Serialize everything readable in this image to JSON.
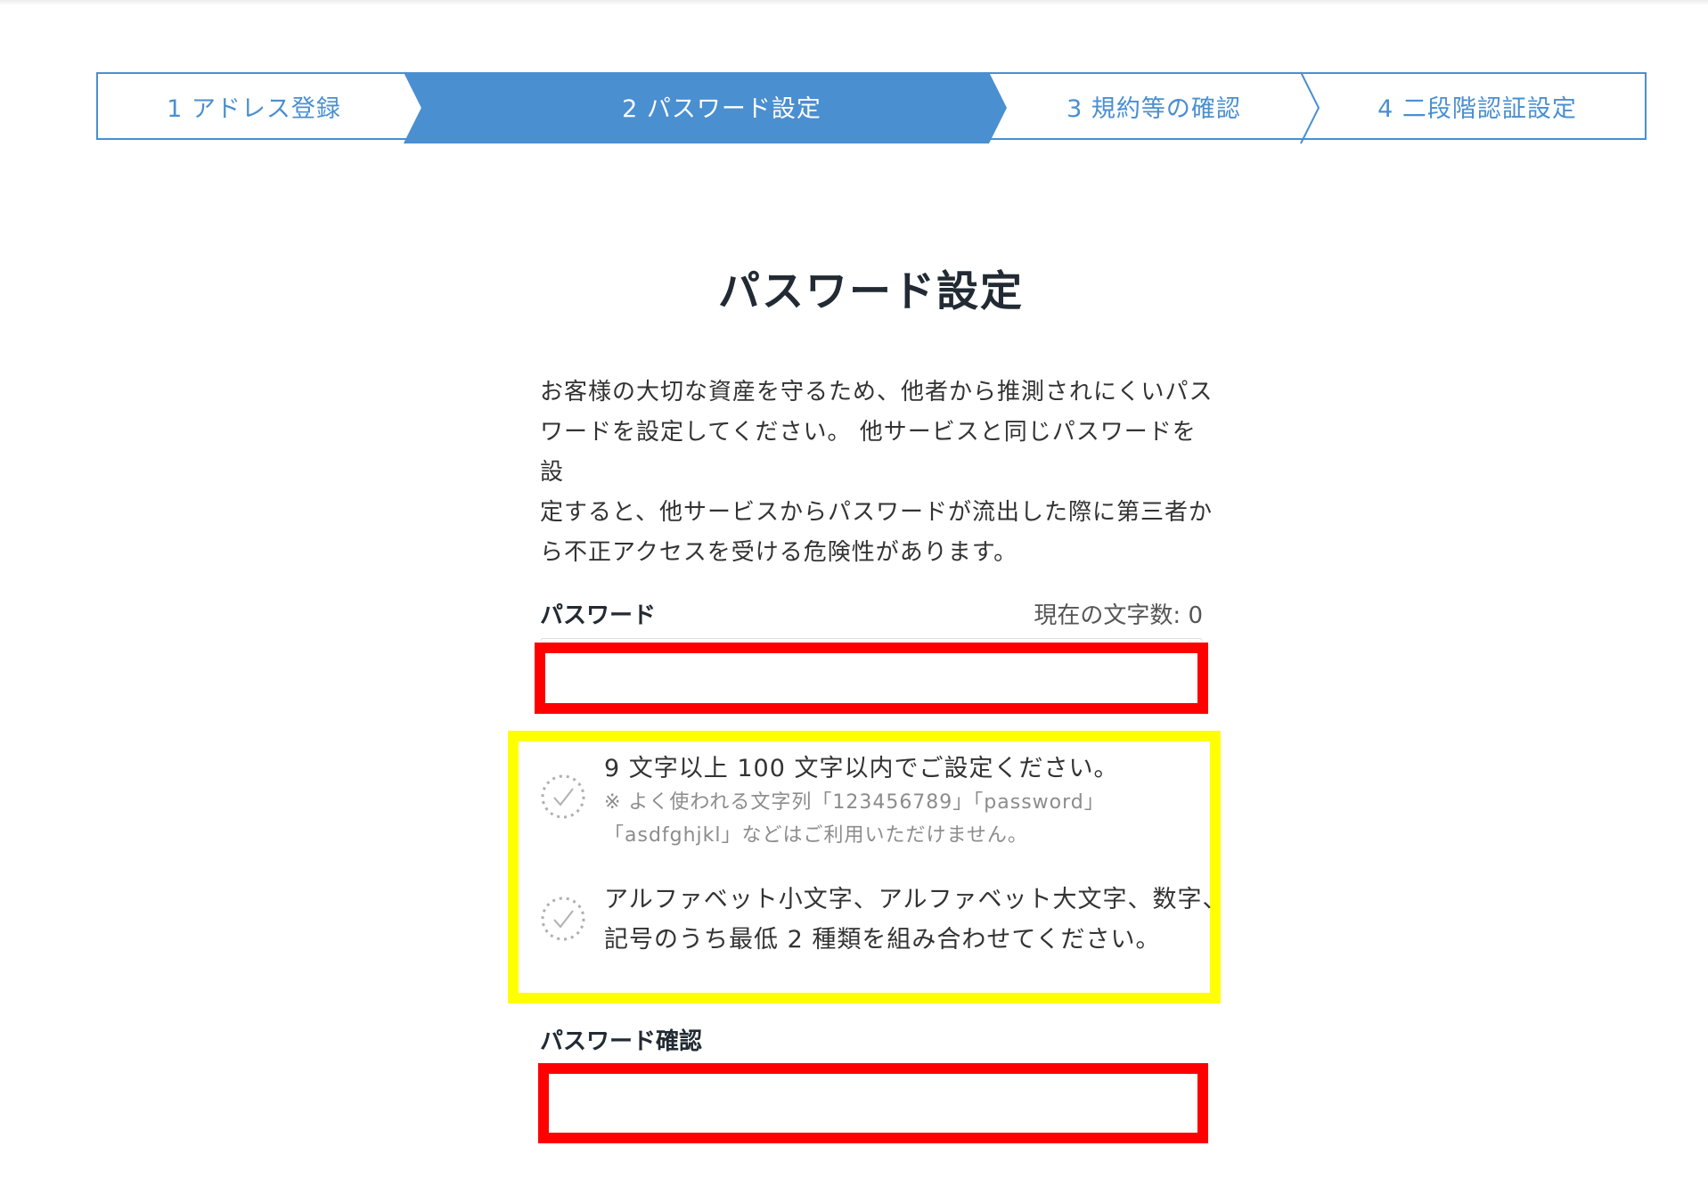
{
  "stepper": {
    "steps": [
      {
        "label": "1 アドレス登録",
        "active": false
      },
      {
        "label": "2 パスワード設定",
        "active": true
      },
      {
        "label": "3 規約等の確認",
        "active": false
      },
      {
        "label": "4 二段階認証設定",
        "active": false
      }
    ],
    "active_color": "#4a8fd0"
  },
  "page": {
    "title": "パスワード設定",
    "description_lines": [
      "お客様の大切な資産を守るため、他者から推測されにくいパス",
      "ワードを設定してください。 他サービスと同じパスワードを設",
      "定すると、他サービスからパスワードが流出した際に第三者か",
      "ら不正アクセスを受ける危険性があります。"
    ]
  },
  "password_field": {
    "label": "パスワード",
    "char_count": "現在の文字数: 0",
    "value": ""
  },
  "rules": [
    {
      "icon": "check-circle-dotted-icon",
      "text": "9 文字以上 100 文字以内でご設定ください。",
      "notes": [
        "※ よく使われる文字列「123456789」「password」",
        "「asdfghjkl」などはご利用いただけません。"
      ]
    },
    {
      "icon": "check-circle-dotted-icon",
      "lines": [
        "アルファベット小文字、アルファベット大文字、数字、",
        "記号のうち最低 2 種類を組み合わせてください。"
      ]
    }
  ],
  "confirm_field": {
    "label": "パスワード確認",
    "value": ""
  },
  "highlight_colors": {
    "input_outline": "#ff0000",
    "rules_outline": "#ffff00"
  }
}
